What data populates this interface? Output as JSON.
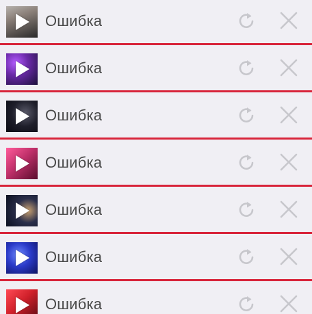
{
  "items": [
    {
      "title": "Ошибка",
      "thumb_icon": "video-thumbnail-icon",
      "thumb_colors": [
        "#8a7f78",
        "#2a2a2a"
      ]
    },
    {
      "title": "Ошибка",
      "thumb_icon": "video-thumbnail-icon",
      "thumb_colors": [
        "#6b2aa8",
        "#1b0f3a"
      ]
    },
    {
      "title": "Ошибка",
      "thumb_icon": "video-thumbnail-icon",
      "thumb_colors": [
        "#1e1e2a",
        "#0a0a12"
      ]
    },
    {
      "title": "Ошибка",
      "thumb_icon": "video-thumbnail-icon",
      "thumb_colors": [
        "#c0306a",
        "#5a0c2c"
      ]
    },
    {
      "title": "Ошибка",
      "thumb_icon": "video-thumbnail-icon",
      "thumb_colors": [
        "#2a2e4a",
        "#0c1020"
      ]
    },
    {
      "title": "Ошибка",
      "thumb_icon": "video-thumbnail-icon",
      "thumb_colors": [
        "#2a3ac8",
        "#0d1260"
      ]
    },
    {
      "title": "Ошибка",
      "thumb_icon": "video-thumbnail-icon",
      "thumb_colors": [
        "#d0202a",
        "#5a0a12"
      ]
    }
  ],
  "icons": {
    "retry": "retry-icon",
    "close": "close-icon"
  },
  "colors": {
    "background": "#f0eff4",
    "separator": "#d8243a",
    "text": "#4a4a4a",
    "icon": "#c7c7cc"
  }
}
